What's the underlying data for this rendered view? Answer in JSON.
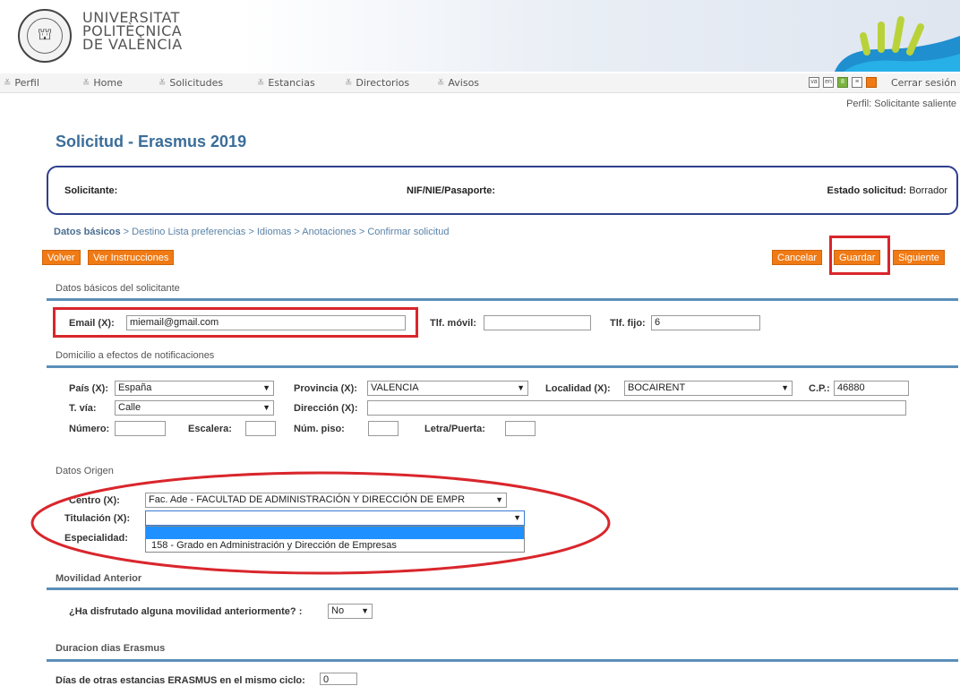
{
  "header": {
    "logo_line1": "UNIVERSITAT",
    "logo_line2": "POLITÈCNICA",
    "logo_line3": "DE VALÈNCIA"
  },
  "nav": {
    "items": [
      "Perfil",
      "Home",
      "Solicitudes",
      "Estancias",
      "Directorios",
      "Avisos"
    ],
    "langs": [
      "va",
      "en",
      "8",
      "≡"
    ],
    "logout": "Cerrar sesión",
    "profile": "Perfil: Solicitante saliente"
  },
  "page_title": "Solicitud - Erasmus 2019",
  "applicant": {
    "applicant_label": "Solicitante:",
    "nif_label": "NIF/NIE/Pasaporte:",
    "status_label": "Estado solicitud:",
    "status_value": "Borrador"
  },
  "breadcrumb": {
    "current": "Datos básicos",
    "rest": " > Destino Lista preferencias > Idiomas > Anotaciones > Confirmar solicitud"
  },
  "buttons": {
    "volver": "Volver",
    "instrucciones": "Ver Instrucciones",
    "cancelar": "Cancelar",
    "guardar": "Guardar",
    "siguiente": "Siguiente"
  },
  "datos_basicos": {
    "section": "Datos básicos del solicitante",
    "email_label": "Email (X):",
    "email_value": "miemail@gmail.com",
    "movil_label": "Tlf. móvil:",
    "movil_value": "",
    "fijo_label": "Tlf. fijo:",
    "fijo_value": "6"
  },
  "domicilio": {
    "section": "Domicilio a efectos de notificaciones",
    "pais_label": "País (X):",
    "pais_value": "España",
    "provincia_label": "Provincia (X):",
    "provincia_value": "VALENCIA",
    "localidad_label": "Localidad (X):",
    "localidad_value": "BOCAIRENT",
    "cp_label": "C.P.:",
    "cp_value": "46880",
    "via_label": "T. vía:",
    "via_value": "Calle",
    "direccion_label": "Dirección (X):",
    "direccion_value": "",
    "numero_label": "Número:",
    "numero_value": "",
    "escalera_label": "Escalera:",
    "piso_label": "Núm. piso:",
    "letra_label": "Letra/Puerta:"
  },
  "datos_origen": {
    "section": "Datos Origen",
    "centro_label": "Centro (X):",
    "centro_value": "Fac. Ade - FACULTAD DE ADMINISTRACIÓN Y DIRECCIÓN DE EMPR",
    "titulacion_label": "Titulación (X):",
    "titulacion_value": "",
    "especialidad_label": "Especialidad:",
    "titulacion_options": [
      "",
      "158 - Grado en Administración y Dirección de Empresas"
    ]
  },
  "movilidad": {
    "section": "Movilidad Anterior",
    "question": "¿Ha disfrutado alguna movilidad anteriormente? :",
    "answer": "No"
  },
  "duracion": {
    "section": "Duracion dias Erasmus",
    "label": "Días de otras estancias ERASMUS en el mismo ciclo:",
    "value": "0"
  },
  "colors": {
    "orange": "#f07a14",
    "blue_title": "#3a6d9a",
    "highlight_red": "#d9262c",
    "box_blue": "#2e3f8f"
  }
}
